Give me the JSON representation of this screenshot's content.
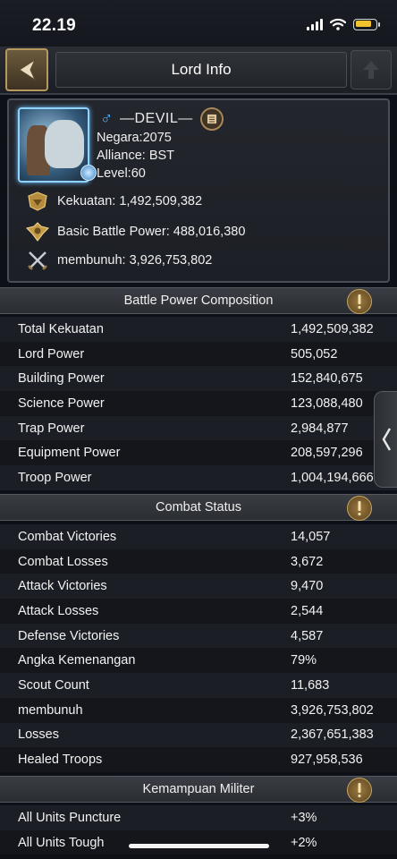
{
  "status_bar": {
    "time": "22.19",
    "battery_level": 0.85,
    "battery_color": "#f2c230"
  },
  "header": {
    "title": "Lord Info",
    "back_icon": "chevron-left-icon"
  },
  "lord": {
    "gender_symbol": "♂",
    "name": "—DEVIL—",
    "negara": "Negara:2075",
    "alliance": "Alliance: BST",
    "level": "Level:60",
    "kekuatan": "Kekuatan: 1,492,509,382",
    "basic_battle_power": "Basic Battle Power: 488,016,380",
    "membunuh": "membunuh: 3,926,753,802"
  },
  "battle_power": {
    "title": "Battle Power Composition",
    "rows": [
      {
        "label": "Total Kekuatan",
        "value": "1,492,509,382"
      },
      {
        "label": "Lord Power",
        "value": "505,052"
      },
      {
        "label": "Building Power",
        "value": "152,840,675"
      },
      {
        "label": "Science Power",
        "value": "123,088,480"
      },
      {
        "label": "Trap Power",
        "value": "2,984,877"
      },
      {
        "label": "Equipment Power",
        "value": "208,597,296"
      },
      {
        "label": "Troop Power",
        "value": "1,004,194,666"
      }
    ]
  },
  "combat_status": {
    "title": "Combat Status",
    "rows": [
      {
        "label": "Combat Victories",
        "value": "14,057"
      },
      {
        "label": "Combat Losses",
        "value": "3,672"
      },
      {
        "label": "Attack Victories",
        "value": "9,470"
      },
      {
        "label": "Attack Losses",
        "value": "2,544"
      },
      {
        "label": "Defense Victories",
        "value": "4,587"
      },
      {
        "label": "Angka Kemenangan",
        "value": "79%"
      },
      {
        "label": "Scout Count",
        "value": "11,683"
      },
      {
        "label": "membunuh",
        "value": "3,926,753,802"
      },
      {
        "label": "Losses",
        "value": "2,367,651,383"
      },
      {
        "label": "Healed Troops",
        "value": "927,958,536"
      }
    ]
  },
  "military": {
    "title": "Kemampuan Militer",
    "rows": [
      {
        "label": "All Units Puncture",
        "value": "+3%"
      },
      {
        "label": "All Units Tough",
        "value": "+2%"
      }
    ]
  }
}
